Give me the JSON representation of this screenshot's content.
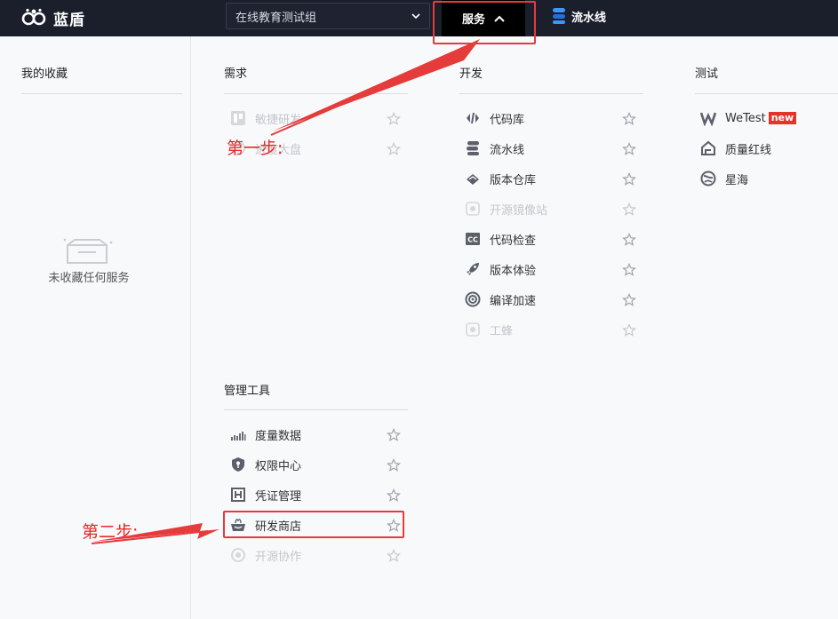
{
  "header": {
    "logo_text": "蓝盾",
    "team_selector": "在线教育测试组",
    "services_tab": "服务",
    "pipeline_tab": "流水线"
  },
  "favorites": {
    "title": "我的收藏",
    "empty_text": "未收藏任何服务"
  },
  "requirements": {
    "title": "需求",
    "items": [
      {
        "label": "敏捷研发",
        "icon": "kanban-icon",
        "disabled": true
      },
      {
        "label": "进度大盘",
        "icon": "dashboard-icon",
        "disabled": true
      }
    ]
  },
  "development": {
    "title": "开发",
    "items": [
      {
        "label": "代码库",
        "icon": "code-repo-icon",
        "disabled": false
      },
      {
        "label": "流水线",
        "icon": "pipeline-icon",
        "disabled": false
      },
      {
        "label": "版本仓库",
        "icon": "artifact-repo-icon",
        "disabled": false
      },
      {
        "label": "开源镜像站",
        "icon": "mirror-icon",
        "disabled": true
      },
      {
        "label": "代码检查",
        "icon": "code-check-icon",
        "disabled": false
      },
      {
        "label": "版本体验",
        "icon": "rocket-icon",
        "disabled": false
      },
      {
        "label": "编译加速",
        "icon": "turbo-icon",
        "disabled": false
      },
      {
        "label": "工蜂",
        "icon": "gongfeng-icon",
        "disabled": true
      }
    ]
  },
  "testing": {
    "title": "测试",
    "items": [
      {
        "label": "WeTest",
        "badge": "new",
        "icon": "wetest-icon",
        "disabled": false
      },
      {
        "label": "质量红线",
        "icon": "quality-gate-icon",
        "disabled": false
      },
      {
        "label": "星海",
        "icon": "xinghai-icon",
        "disabled": false
      }
    ]
  },
  "management": {
    "title": "管理工具",
    "items": [
      {
        "label": "度量数据",
        "icon": "metrics-icon",
        "disabled": false
      },
      {
        "label": "权限中心",
        "icon": "permission-icon",
        "disabled": false
      },
      {
        "label": "凭证管理",
        "icon": "ticket-icon",
        "disabled": false
      },
      {
        "label": "研发商店",
        "icon": "store-icon",
        "disabled": false
      },
      {
        "label": "开源协作",
        "icon": "oss-icon",
        "disabled": true
      }
    ]
  },
  "annotations": {
    "step1": "第一步:",
    "step2": "第二步:"
  },
  "colors": {
    "topbar": "#1b1e2b",
    "annotation_red": "#e53b3b",
    "accent_blue": "#3c96ff"
  }
}
